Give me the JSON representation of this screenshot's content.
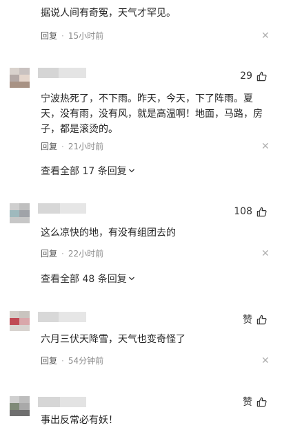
{
  "comments": [
    {
      "text": "据说人间有奇冤，天气才罕见。",
      "reply_label": "回复",
      "time": "15小时前",
      "likes": ""
    },
    {
      "text": "宁波热死了，不下雨。昨天，今天，下了阵雨。夏天，没有雨，没有风，就是高温啊！地面，马路，房子，都是滚烫的。",
      "reply_label": "回复",
      "time": "21小时前",
      "likes": "29",
      "view_all": "查看全部 17 条回复"
    },
    {
      "text": "这么凉快的地，有没有组团去的",
      "reply_label": "回复",
      "time": "22小时前",
      "likes": "108",
      "view_all": "查看全部 48 条回复"
    },
    {
      "text": "六月三伏天降雪，天气也变奇怪了",
      "reply_label": "回复",
      "time": "54分钟前",
      "likes": "赞"
    },
    {
      "text": "事出反常必有妖！",
      "likes": "赞"
    }
  ],
  "colors": {
    "text": "#222222",
    "meta": "#8a8a8a",
    "divider": "#e8e8e8"
  },
  "icons": [
    "thumbs-up-icon",
    "close-icon",
    "chevron-down-icon",
    "avatar"
  ]
}
